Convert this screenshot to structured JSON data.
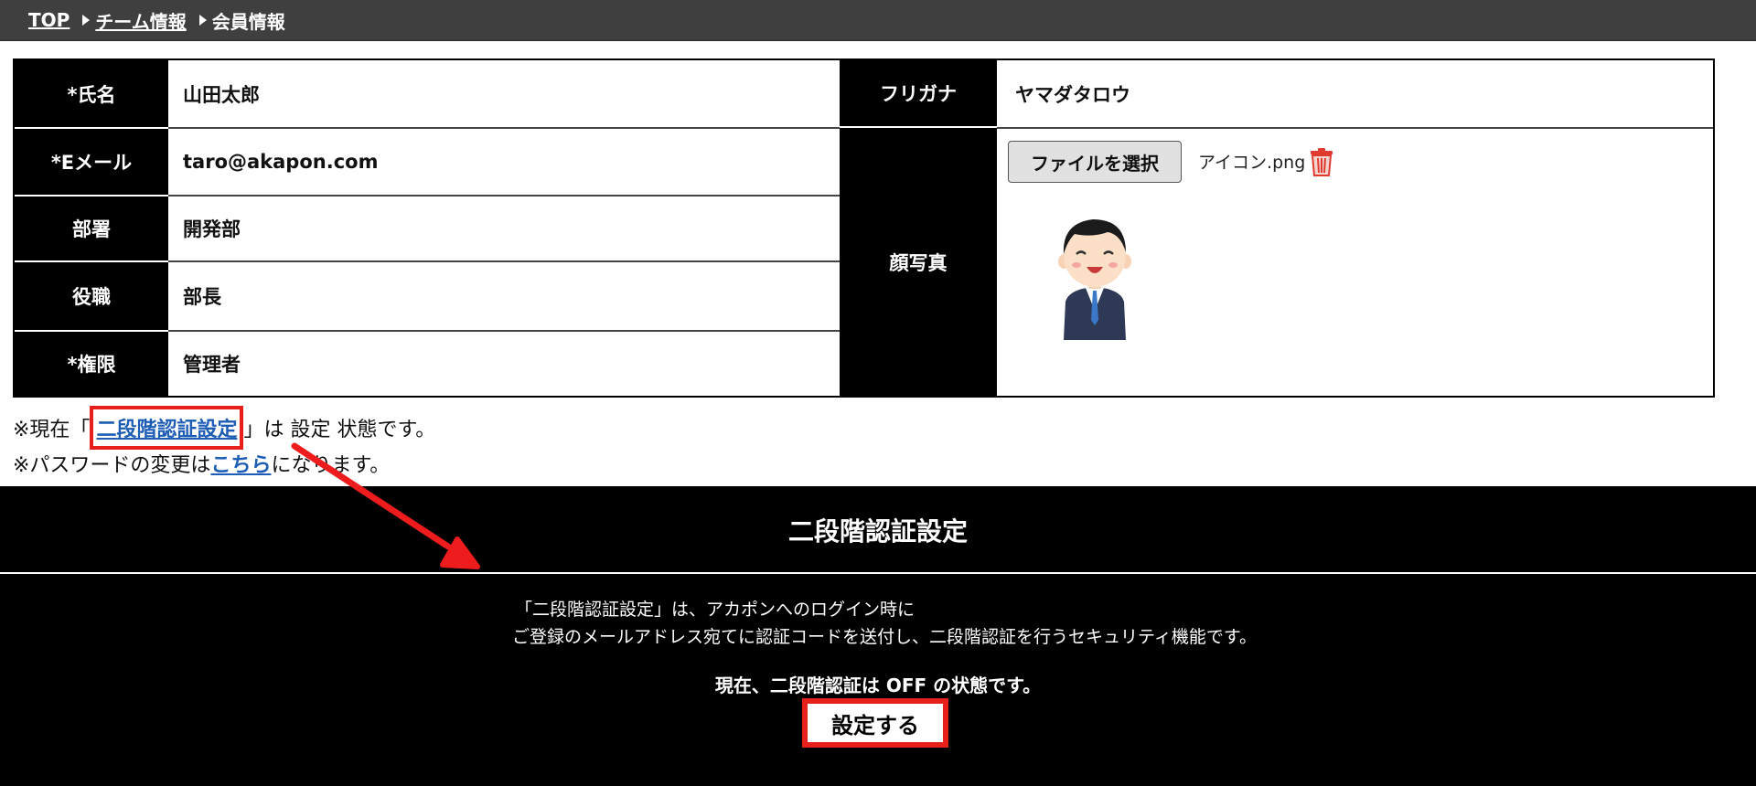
{
  "breadcrumb": {
    "items": [
      {
        "label": "TOP"
      },
      {
        "label": "チーム情報"
      },
      {
        "label": "会員情報"
      }
    ]
  },
  "profile": {
    "name_label": "*氏名",
    "name_value": "山田太郎",
    "furigana_label": "フリガナ",
    "furigana_value": "ヤマダタロウ",
    "email_label": "*Eメール",
    "email_value": "taro@akapon.com",
    "department_label": "部署",
    "department_value": "開発部",
    "position_label": "役職",
    "position_value": "部長",
    "permission_label": "*権限",
    "permission_value": "管理者",
    "photo_label": "顔写真",
    "file_button_label": "ファイルを選択",
    "file_name": "アイコン.png",
    "delete_icon": "trash-icon",
    "avatar_icon": "businessman-avatar"
  },
  "notes": {
    "two_factor_prefix": "※現在「",
    "two_factor_link": "二段階認証設定",
    "two_factor_suffix": "」は 設定 状態です。",
    "password_prefix": "※パスワードの変更は",
    "password_link": "こちら",
    "password_suffix": "になります。"
  },
  "two_factor_panel": {
    "title": "二段階認証設定",
    "description_line1": "「二段階認証設定」は、アカポンへのログイン時に",
    "description_line2": "ご登録のメールアドレス宛てに認証コードを送付し、二段階認証を行うセキュリティ機能です。",
    "status": "現在、二段階認証は OFF の状態です。",
    "button_label": "設定する"
  },
  "colors": {
    "header_bg": "#3f3f3f",
    "label_bg": "#000000",
    "highlight": "#e8201c",
    "link": "#1d5db5"
  }
}
